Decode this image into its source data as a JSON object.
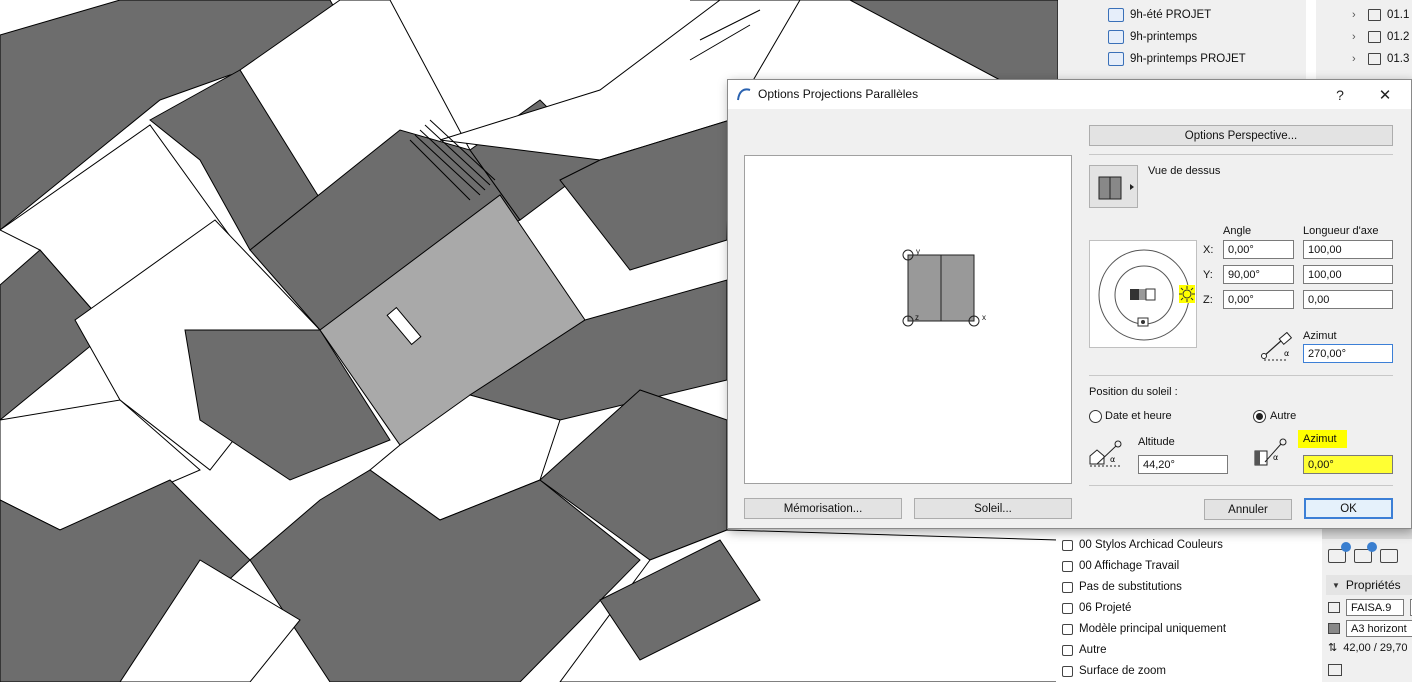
{
  "navigator_top": {
    "views": [
      {
        "label": "9h-été PROJET"
      },
      {
        "label": "9h-printemps"
      },
      {
        "label": "9h-printemps PROJET"
      }
    ],
    "layouts": [
      {
        "label": "01.1"
      },
      {
        "label": "01.2"
      },
      {
        "label": "01.3"
      }
    ]
  },
  "dialog": {
    "title": "Options Projections Parallèles",
    "help": "?",
    "close": "✕",
    "perspective_button": "Options Perspective...",
    "view_name": "Vue de dessus",
    "angle_header": "Angle",
    "axis_header": "Longueur d'axe",
    "rows": [
      {
        "axis": "X:",
        "angle": "0,00°",
        "length": "100,00"
      },
      {
        "axis": "Y:",
        "angle": "90,00°",
        "length": "100,00"
      },
      {
        "axis": "Z:",
        "angle": "0,00°",
        "length": "0,00"
      }
    ],
    "azimut_label": "Azimut",
    "azimut_value": "270,00°",
    "sun_section": "Position du soleil :",
    "radio_date": "Date et heure",
    "radio_other": "Autre",
    "altitude_label": "Altitude",
    "altitude_value": "44,20°",
    "sun_azimut_label": "Azimut",
    "sun_azimut_value": "0,00°",
    "memo_button": "Mémorisation...",
    "sun_button": "Soleil...",
    "cancel_button": "Annuler",
    "ok_button": "OK",
    "preview_axes": {
      "y": "y",
      "z": "z",
      "x": "x"
    },
    "highlight_color": "#ffff00"
  },
  "quick_options": [
    {
      "label": "00 Stylos Archicad Couleurs",
      "icon": "pen-icon"
    },
    {
      "label": "00 Affichage Travail",
      "icon": "display-icon"
    },
    {
      "label": "Pas de substitutions",
      "icon": "override-icon"
    },
    {
      "label": "06 Projeté",
      "icon": "renovation-icon"
    },
    {
      "label": "Modèle principal uniquement",
      "icon": "model-icon"
    },
    {
      "label": "Autre",
      "icon": "dimension-icon"
    },
    {
      "label": "Surface de zoom",
      "icon": "zoom-icon"
    }
  ],
  "properties": {
    "title": "Propriétés",
    "id_value": "FAISA.9",
    "format_value": "A3 horizont",
    "size_value": "42,00 / 29,70"
  }
}
